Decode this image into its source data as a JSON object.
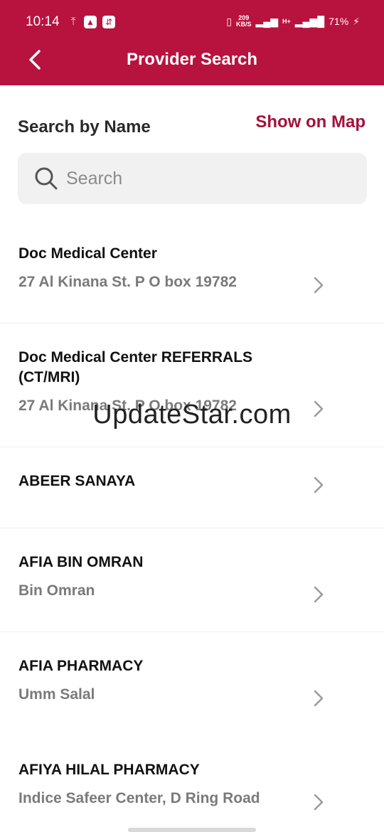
{
  "status_bar": {
    "time": "10:14",
    "net_speed_value": "209",
    "net_speed_unit": "KB/S",
    "network_type": "H+",
    "battery": "71%"
  },
  "header": {
    "title": "Provider Search",
    "color": "#b8123e"
  },
  "search": {
    "label": "Search by Name",
    "map_link": "Show on Map",
    "placeholder": "Search"
  },
  "providers": [
    {
      "name": " Doc Medical Center",
      "address": "27 Al Kinana St. P O box 19782"
    },
    {
      "name": " Doc Medical Center  REFERRALS (CT/MRI)",
      "address": "27 Al Kinana St. P O box 19782"
    },
    {
      "name": "ABEER SANAYA",
      "address": ""
    },
    {
      "name": "AFIA BIN OMRAN",
      "address": "Bin Omran"
    },
    {
      "name": "AFIA PHARMACY",
      "address": "Umm Salal"
    },
    {
      "name": "AFIYA HILAL PHARMACY",
      "address": "Indice Safeer Center, D Ring Road"
    }
  ],
  "watermark": "UpdateStar.com"
}
